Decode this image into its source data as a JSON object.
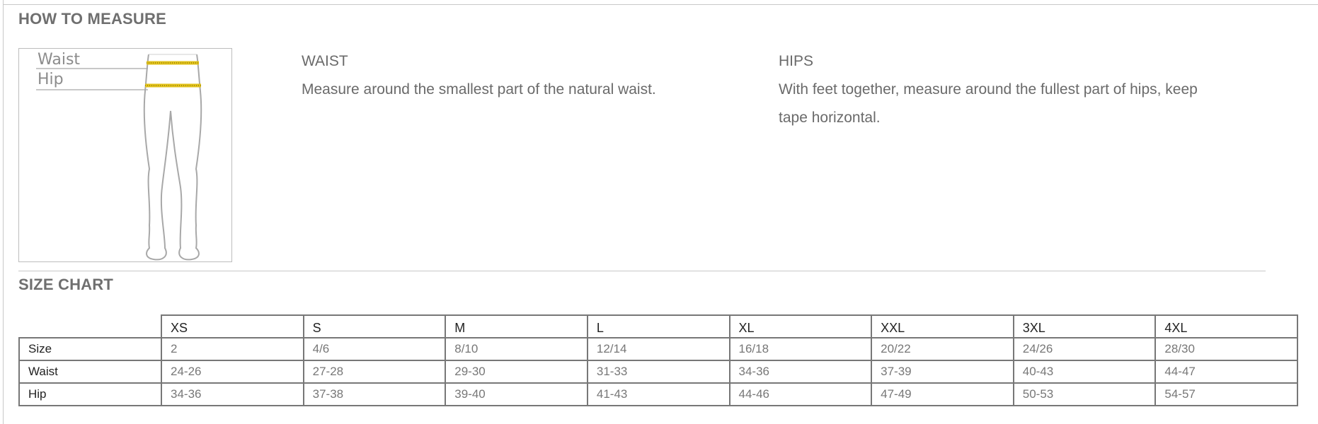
{
  "how_to_measure": {
    "heading": "HOW TO MEASURE",
    "illustration": {
      "waist_label": "Waist",
      "hip_label": "Hip",
      "tape_color": "#e2c21a",
      "outline_color": "#a8a8a8"
    },
    "waist": {
      "title": "WAIST",
      "text": "Measure around the smallest part of the natural waist."
    },
    "hips": {
      "title": "HIPS",
      "text": "With feet together, measure around the fullest part of hips, keep tape horizontal."
    }
  },
  "size_chart": {
    "heading": "SIZE CHART",
    "columns": [
      "XS",
      "S",
      "M",
      "L",
      "XL",
      "XXL",
      "3XL",
      "4XL"
    ],
    "rows": [
      {
        "label": "Size",
        "values": [
          "2",
          "4/6",
          "8/10",
          "12/14",
          "16/18",
          "20/22",
          "24/26",
          "28/30"
        ]
      },
      {
        "label": "Waist",
        "values": [
          "24-26",
          "27-28",
          "29-30",
          "31-33",
          "34-36",
          "37-39",
          "40-43",
          "44-47"
        ]
      },
      {
        "label": "Hip",
        "values": [
          "34-36",
          "37-38",
          "39-40",
          "41-43",
          "44-46",
          "47-49",
          "50-53",
          "54-57"
        ]
      }
    ]
  }
}
